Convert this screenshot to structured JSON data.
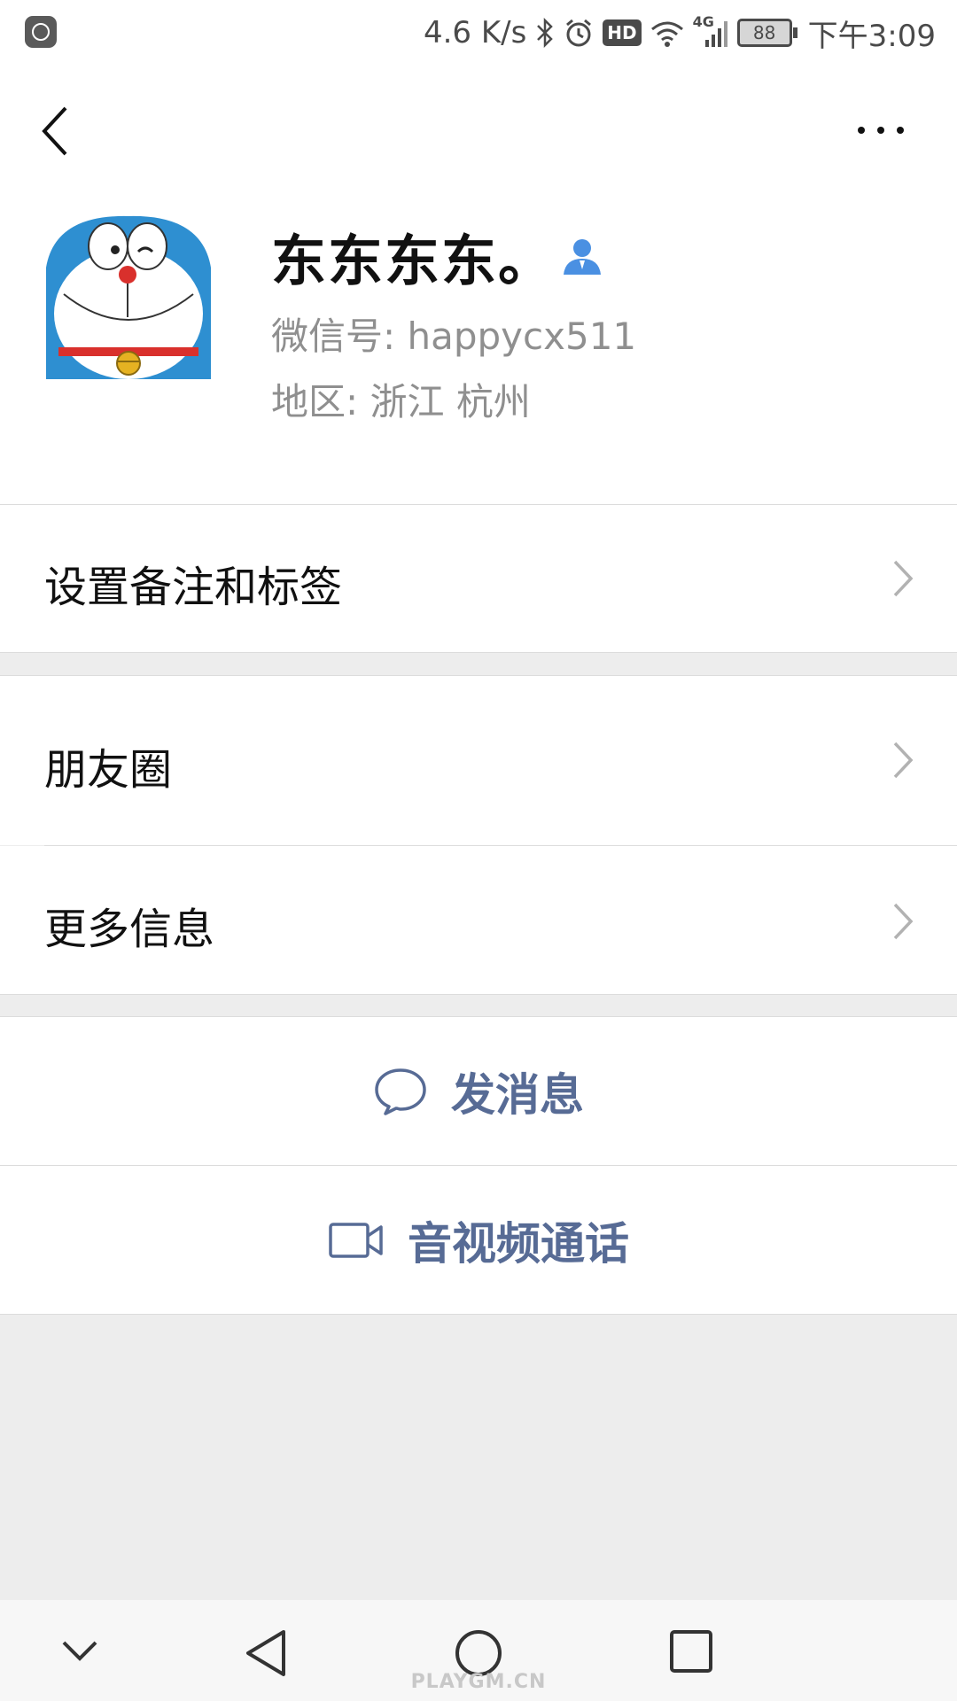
{
  "status_bar": {
    "speed": "4.6 K/s",
    "network": "4G",
    "battery": "88",
    "time": "下午3:09",
    "hd_label": "HD",
    "icons": [
      "mi-icon",
      "bluetooth-icon",
      "alarm-icon",
      "hd-icon",
      "wifi-icon",
      "signal-icon",
      "battery-icon"
    ]
  },
  "header": {
    "back_icon": "back-chevron-icon",
    "more_icon": "more-dots-icon"
  },
  "profile": {
    "name": "东东东东。",
    "contact_icon": "contact-person-icon",
    "wechat_id": "微信号: happycx511",
    "region": "地区: 浙江  杭州"
  },
  "cells": {
    "remark": "设置备注和标签",
    "moments": "朋友圈",
    "more_info": "更多信息"
  },
  "actions": {
    "message": "发消息",
    "call": "音视频通话"
  },
  "colors": {
    "link": "#576b95",
    "contact_icon": "#4a90e2",
    "background": "#ededed"
  },
  "watermark": "PLAYGM.CN"
}
